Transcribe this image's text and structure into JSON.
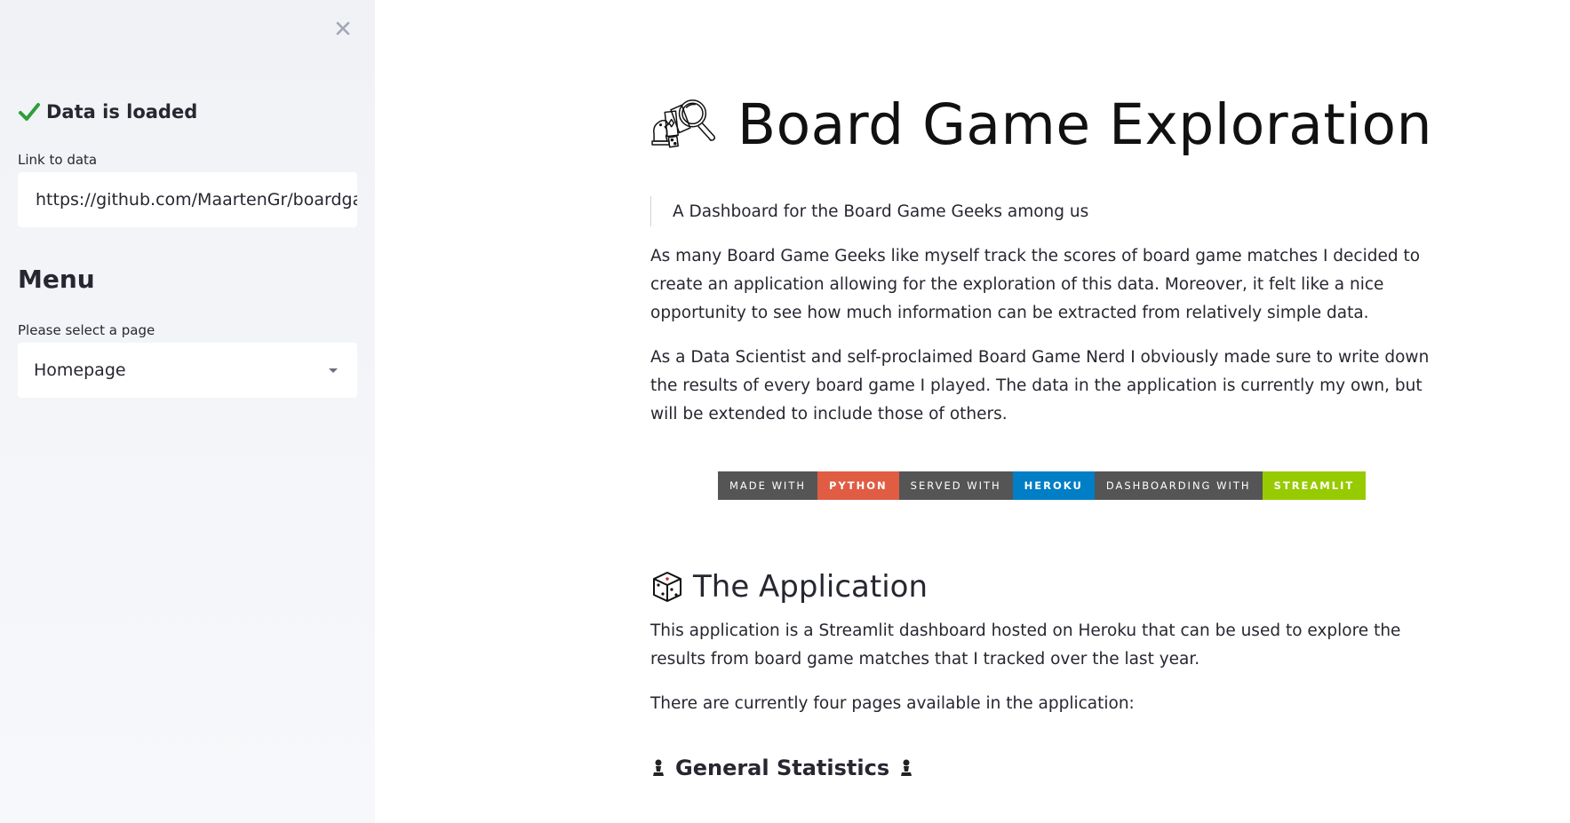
{
  "sidebar": {
    "status_text": "Data is loaded",
    "link_label": "Link to data",
    "link_value": "https://github.com/MaartenGr/boardgame",
    "menu_heading": "Menu",
    "select_label": "Please select a page",
    "select_value": "Homepage"
  },
  "main": {
    "title": "Board Game Exploration",
    "quote": "A Dashboard for the Board Game Geeks among us",
    "paragraph1": "As many Board Game Geeks like myself track the scores of board game matches I decided to create an application allowing for the exploration of this data. Moreover, it felt like a nice opportunity to see how much information can be extracted from relatively simple data.",
    "paragraph2": "As a Data Scientist and self-proclaimed Board Game Nerd I obviously made sure to write down the results of every board game I played. The data in the application is currently my own, but will be extended to include those of others.",
    "badges": [
      {
        "text": "MADE WITH",
        "color": "#555555"
      },
      {
        "text": "PYTHON",
        "color": "#e05d44"
      },
      {
        "text": "SERVED WITH",
        "color": "#555555"
      },
      {
        "text": "HEROKU",
        "color": "#007ec6"
      },
      {
        "text": "DASHBOARDING WITH",
        "color": "#555555"
      },
      {
        "text": "STREAMLIT",
        "color": "#97ca00"
      }
    ],
    "section_heading": "The Application",
    "section_para1": "This application is a Streamlit dashboard hosted on Heroku that can be used to explore the results from board game matches that I tracked over the last year.",
    "section_para2": "There are currently four pages available in the application:",
    "subheading": "General Statistics"
  },
  "icons": {
    "close": "close-icon",
    "check": "check-mark-icon",
    "caret": "caret-down-icon",
    "title": "board-game-magnifier-icon",
    "dice": "dice-icon",
    "pawn": "chess-pawn-icon"
  },
  "colors": {
    "sidebar_bg": "#f0f2f6",
    "check_green": "#2e9e3a",
    "text": "#262730"
  }
}
